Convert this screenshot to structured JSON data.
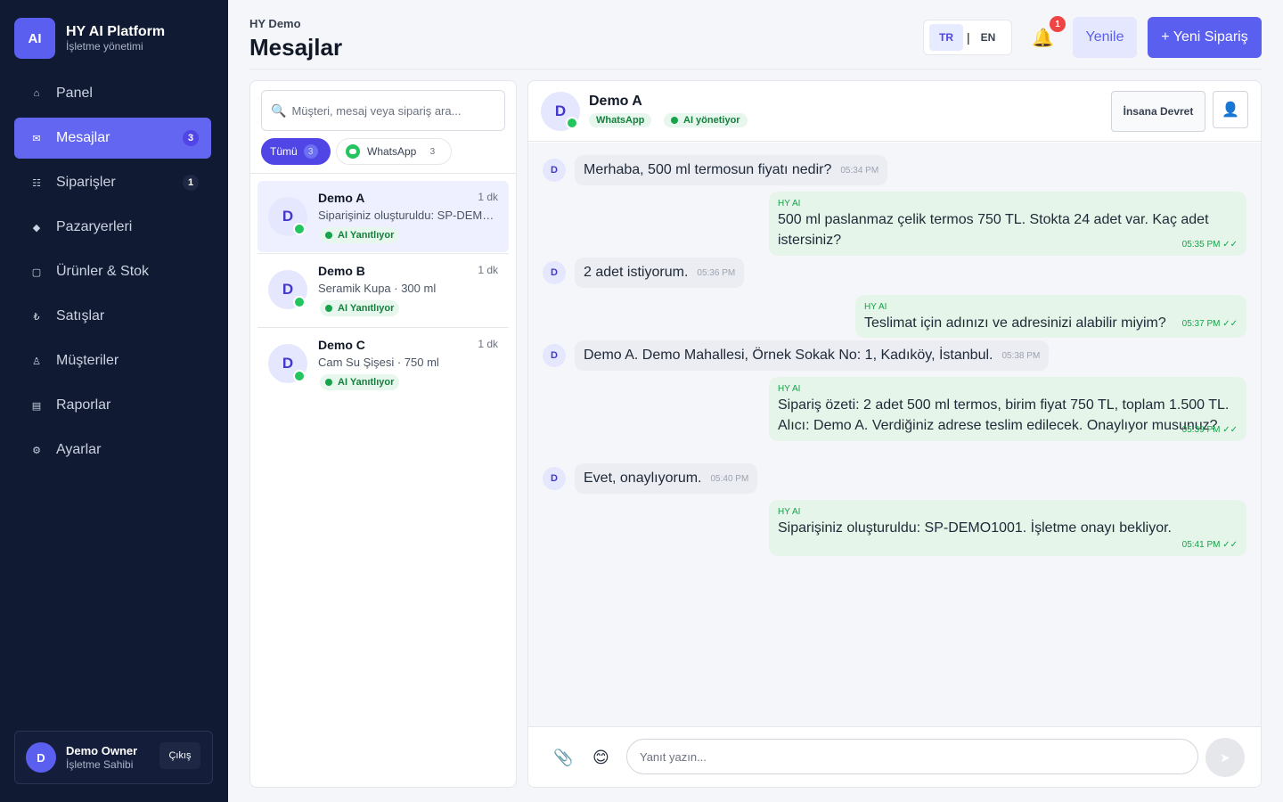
{
  "brand": {
    "logo": "AI",
    "title": "HY AI Platform",
    "subtitle": "İşletme yönetimi"
  },
  "nav": [
    {
      "icon": "⌂",
      "label": "Panel",
      "badge": ""
    },
    {
      "icon": "✉",
      "label": "Mesajlar",
      "badge": "3"
    },
    {
      "icon": "☷",
      "label": "Siparişler",
      "badge": "1"
    },
    {
      "icon": "◆",
      "label": "Pazaryerleri",
      "badge": ""
    },
    {
      "icon": "▢",
      "label": "Ürünler & Stok",
      "badge": ""
    },
    {
      "icon": "₺",
      "label": "Satışlar",
      "badge": ""
    },
    {
      "icon": "♙",
      "label": "Müşteriler",
      "badge": ""
    },
    {
      "icon": "▤",
      "label": "Raporlar",
      "badge": ""
    },
    {
      "icon": "⚙",
      "label": "Ayarlar",
      "badge": ""
    }
  ],
  "user": {
    "initial": "D",
    "name": "Demo Owner",
    "role": "İşletme Sahibi",
    "logout": "Çıkış"
  },
  "header": {
    "crumb": "HY Demo",
    "title": "Mesajlar",
    "lang_active": "TR",
    "lang_sep": "|",
    "lang_other": "EN",
    "bell_icon": "🔔",
    "notifications": "1",
    "refresh": "Yenile",
    "new_order": "+ Yeni Sipariş"
  },
  "list": {
    "search_icon": "🔍",
    "search_placeholder": "Müşteri, mesaj veya sipariş ara...",
    "filter_all": "Tümü",
    "filter_all_count": "3",
    "filter_wa": "WhatsApp",
    "filter_wa_count": "3",
    "conversations": [
      {
        "initial": "D",
        "name": "Demo A",
        "time": "1 dk",
        "preview": "Siparişiniz oluşturuldu: SP-DEMO1001. İşletme onayı bekliyor.",
        "status": "AI Yanıtlıyor"
      },
      {
        "initial": "D",
        "name": "Demo B",
        "time": "1 dk",
        "preview": "Seramik Kupa · 300 ml",
        "status": "AI Yanıtlıyor"
      },
      {
        "initial": "D",
        "name": "Demo C",
        "time": "1 dk",
        "preview": "Cam Su Şişesi · 750 ml",
        "status": "AI Yanıtlıyor"
      }
    ]
  },
  "chat": {
    "initial": "D",
    "name": "Demo A",
    "channel": "WhatsApp",
    "ai_status": "AI yönetiyor",
    "handoff": "İnsana Devret",
    "person_icon": "👤",
    "messages": [
      {
        "text": "Merhaba, 500 ml termosun fiyatı nedir?",
        "time": "05:34 PM"
      },
      {
        "label": "HY AI",
        "text": "500 ml paslanmaz çelik termos 750 TL. Stokta 24 adet var. Kaç adet istersiniz?",
        "time": "05:35 PM ✓✓"
      },
      {
        "text": "2 adet istiyorum.",
        "time": "05:36 PM"
      },
      {
        "label": "HY AI",
        "text": "Teslimat için adınızı ve adresinizi alabilir miyim?",
        "time": "05:37 PM ✓✓"
      },
      {
        "text": "Demo A. Demo Mahallesi, Örnek Sokak No: 1, Kadıköy, İstanbul.",
        "time": "05:38 PM"
      },
      {
        "label": "HY AI",
        "text": "Sipariş özeti: 2 adet 500 ml termos, birim fiyat 750 TL, toplam 1.500 TL. Alıcı: Demo A. Verdiğiniz adrese teslim edilecek. Onaylıyor musunuz?",
        "time": "05:39 PM ✓✓"
      },
      {
        "text": "Evet, onaylıyorum.",
        "time": "05:40 PM"
      },
      {
        "label": "HY AI",
        "text": "Siparişiniz oluşturuldu: SP-DEMO1001. İşletme onayı bekliyor.",
        "time": "05:41 PM ✓✓"
      }
    ],
    "attach_icon": "📎",
    "emoji_icon": "😊",
    "reply_placeholder": "Yanıt yazın...",
    "send_icon": "➤"
  },
  "colors": {
    "accent": "#5b5fef",
    "sidebar": "#111a33",
    "ai_bubble": "#e6f5e9",
    "success": "#16a34a",
    "alert": "#ef4444"
  }
}
